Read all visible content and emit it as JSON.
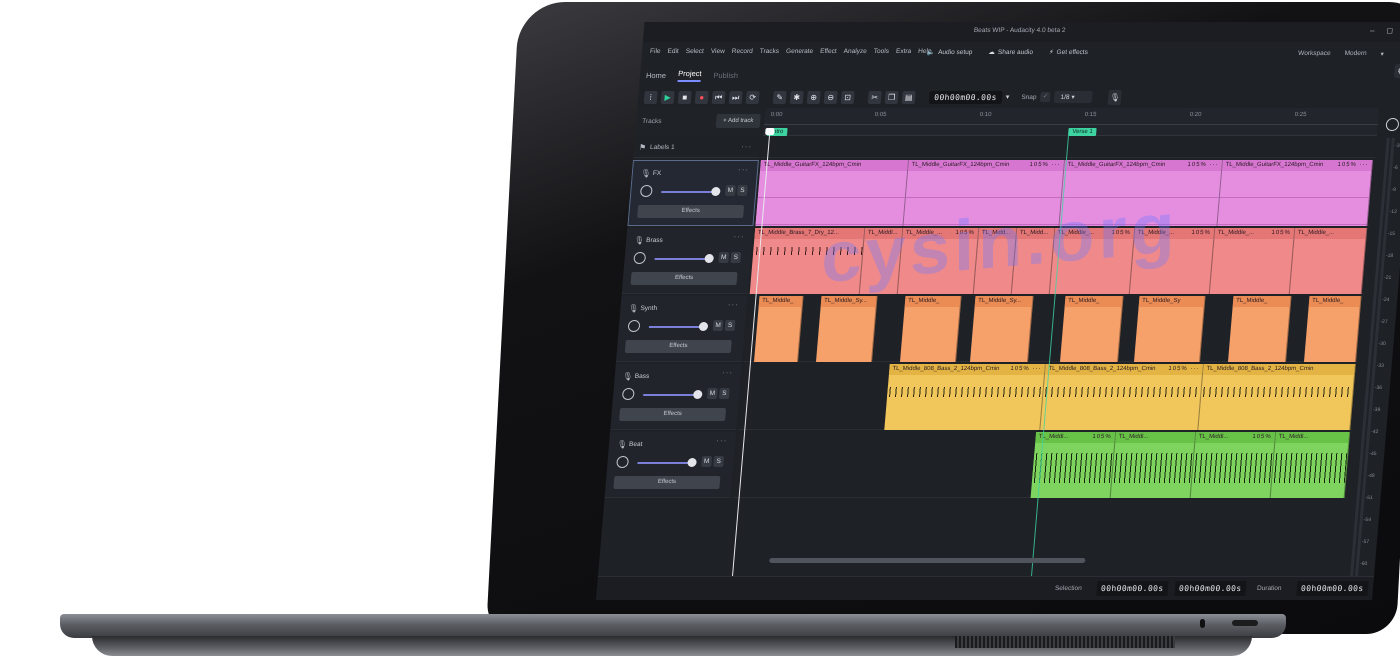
{
  "window": {
    "title": "Beats WIP - Audacity 4.0 beta 2",
    "controls": [
      "–",
      "◻",
      "✕"
    ]
  },
  "menu": [
    "File",
    "Edit",
    "Select",
    "View",
    "Record",
    "Tracks",
    "Generate",
    "Effect",
    "Analyze",
    "Tools",
    "Extra",
    "Help"
  ],
  "actions": {
    "audio_setup": "Audio setup",
    "share_audio": "Share audio",
    "get_effects": "Get effects"
  },
  "workspace": {
    "label": "Workspace",
    "value": "Modern"
  },
  "tabs": [
    {
      "label": "Home",
      "state": "normal"
    },
    {
      "label": "Project",
      "state": "active"
    },
    {
      "label": "Publish",
      "state": "dim"
    }
  ],
  "transport": {
    "timecode": "00h00m00.00s",
    "snap_label": "Snap",
    "snap_value": "1/8"
  },
  "ruler": {
    "ticks": [
      "0:00",
      "0:05",
      "0:10",
      "0:15",
      "0:20",
      "0:25"
    ],
    "markers": [
      "Intro",
      "Verse 1"
    ]
  },
  "track_panel": {
    "header": "Tracks",
    "add_track": "Add track",
    "label_track": "Labels 1",
    "effects_label": "Effects",
    "mute_label": "M",
    "solo_label": "S",
    "tracks": [
      "FX",
      "Brass",
      "Synth",
      "Bass",
      "Beat"
    ]
  },
  "clips": {
    "fx": "TL_Middle_GuitarFX_124bpm_Cmin",
    "fx_rate": "105%",
    "brass_first": "TL_Middle_Brass_7_Dry_12...",
    "brass_short": "TL_Middl...",
    "brass_mid": "TL_Middle_...",
    "brass_small": "TL_Midd...",
    "synth_short": "TL_Middle_",
    "synth_sy": "TL_Middle_Sy...",
    "synth_mid": "TL_Middle_Sy",
    "bass": "TL_Middle_808_Bass_2_124bpm_Cmin",
    "beat": "TL_Middl..."
  },
  "meter": {
    "labels": [
      "-3",
      "-6",
      "-9",
      "-12",
      "-15",
      "-18",
      "-21",
      "-24",
      "-27",
      "-30",
      "-33",
      "-36",
      "-39",
      "-42",
      "-45",
      "-48",
      "-51",
      "-54",
      "-57",
      "-60"
    ]
  },
  "footer": {
    "selection_label": "Selection",
    "selection_start": "00h00m00.00s",
    "selection_end": "00h00m00.00s",
    "duration_label": "Duration",
    "duration": "00h00m00.00s"
  },
  "watermark": "cysin.org",
  "colors": {
    "fx": "#e58ee0",
    "brass": "#f08a8a",
    "synth": "#f6a06a",
    "bass": "#f1c75c",
    "beat": "#7fd45f",
    "accent": "#7a8cff",
    "marker": "#3ed4a2"
  }
}
